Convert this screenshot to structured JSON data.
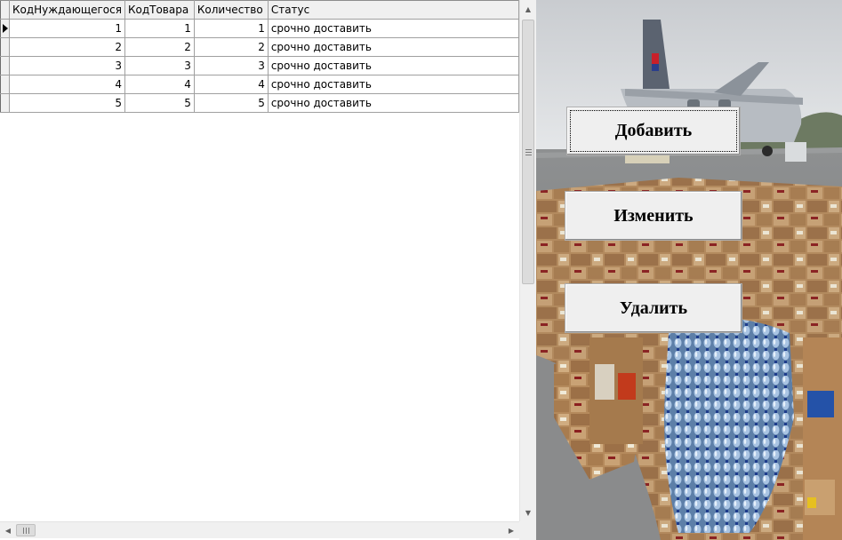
{
  "grid": {
    "columns": [
      "КодНуждающегося",
      "КодТовара",
      "Количество",
      "Статус"
    ],
    "rows": [
      {
        "need_id": "1",
        "item_id": "1",
        "quantity": "1",
        "status": "срочно доставить"
      },
      {
        "need_id": "2",
        "item_id": "2",
        "quantity": "2",
        "status": "срочно доставить"
      },
      {
        "need_id": "3",
        "item_id": "3",
        "quantity": "3",
        "status": "срочно доставить"
      },
      {
        "need_id": "4",
        "item_id": "4",
        "quantity": "4",
        "status": "срочно доставить"
      },
      {
        "need_id": "5",
        "item_id": "5",
        "quantity": "5",
        "status": "срочно доставить"
      }
    ],
    "current_row_index": 0
  },
  "buttons": {
    "add_label": "Добавить",
    "edit_label": "Изменить",
    "delete_label": "Удалить"
  },
  "icons": {
    "current_row": "row-pointer-arrow-icon",
    "scroll_up": "arrow-up-icon",
    "scroll_down": "arrow-down-icon",
    "scroll_left": "arrow-left-icon",
    "scroll_right": "arrow-right-icon"
  },
  "background_image": {
    "subject": "cargo-plane-with-aid-boxes-and-water-bottles"
  }
}
